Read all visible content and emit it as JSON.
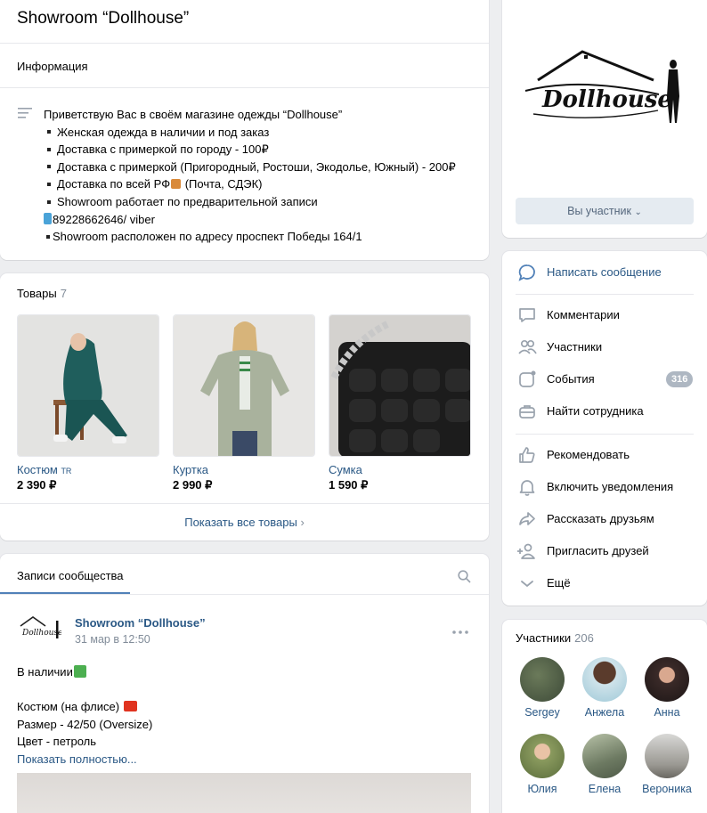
{
  "header": {
    "title": "Showroom “Dollhouse”",
    "info_heading": "Информация",
    "info_lines": [
      "Приветствую Вас в своём магазине одежды “Dollhouse”",
      "Женская одежда в наличии и под заказ",
      "Доставка с примеркой по городу - 100₽",
      "Доставка с примеркой (Пригородный, Ростоши, Экодолье, Южный) - 200₽",
      "Доставка по всей РФ",
      " (Почта, СДЭК)",
      "Showroom работает по предварительной записи",
      "89228662646/ viber",
      "Showroom расположен по адресу проспект Победы 164/1"
    ]
  },
  "goods": {
    "title": "Товары",
    "count": "7",
    "items": [
      {
        "name": "Костюм",
        "suffix": "TR",
        "price": "2 390 ₽"
      },
      {
        "name": "Куртка",
        "price": "2 990 ₽"
      },
      {
        "name": "Сумка",
        "price": "1 590 ₽"
      }
    ],
    "show_all": "Показать все товары"
  },
  "wall": {
    "tab": "Записи сообщества",
    "post": {
      "author": "Showroom “Dollhouse”",
      "date": "31 мар в 12:50",
      "lines": [
        "В наличии",
        "Костюм (на флисе)",
        "Размер - 42/50 (Oversize)",
        "Цвет - петроль"
      ],
      "more": "Показать полностью..."
    }
  },
  "cover": {
    "logo_text": "Dollhouse",
    "member_button": "Вы участник"
  },
  "actions": [
    {
      "label": "Написать сообщение",
      "icon": "message-icon"
    },
    {
      "label": "Комментарии",
      "icon": "comments-icon"
    },
    {
      "label": "Участники",
      "icon": "members-icon"
    },
    {
      "label": "События",
      "icon": "events-icon",
      "badge": "316"
    },
    {
      "label": "Найти сотрудника",
      "icon": "briefcase-icon"
    },
    {
      "label": "Рекомендовать",
      "icon": "like-icon"
    },
    {
      "label": "Включить уведомления",
      "icon": "bell-icon"
    },
    {
      "label": "Рассказать друзьям",
      "icon": "share-icon"
    },
    {
      "label": "Пригласить друзей",
      "icon": "add-user-icon"
    },
    {
      "label": "Ещё",
      "icon": "chevron-down-icon"
    }
  ],
  "members": {
    "title": "Участники",
    "count": "206",
    "list": [
      "Sergey",
      "Анжела",
      "Анна",
      "Юлия",
      "Елена",
      "Вероника"
    ]
  },
  "colors": {
    "link": "#2a5885",
    "accent": "#5181b8",
    "badge": "#aeb7c2",
    "background": "#edeef0"
  }
}
